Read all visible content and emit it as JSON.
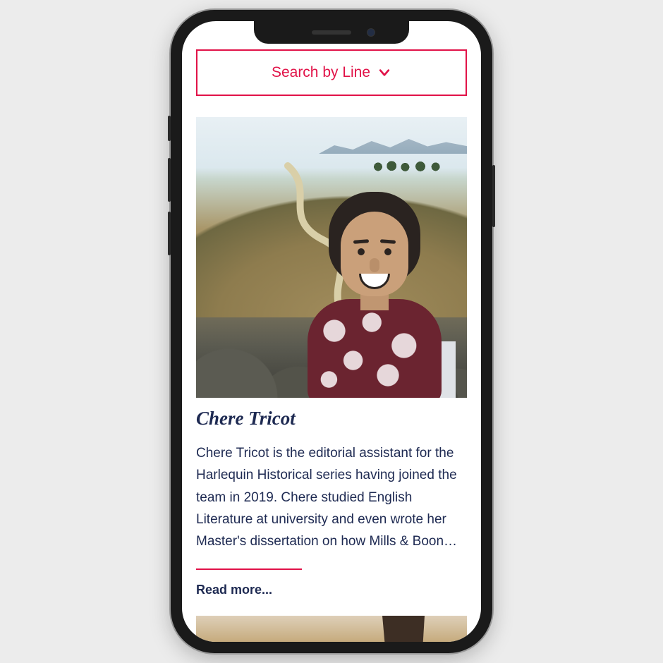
{
  "colors": {
    "accent": "#e11248",
    "text": "#1e2a52"
  },
  "search": {
    "label": "Search by Line"
  },
  "article": {
    "title": "Chere Tricot",
    "body": "Chere Tricot is the editorial assistant for the Harlequin Historical series having joined the team in 2019. Chere studied English Literature at university and even wrote her Master's dissertation on how Mills & Boon…",
    "readmore_label": "Read more..."
  }
}
